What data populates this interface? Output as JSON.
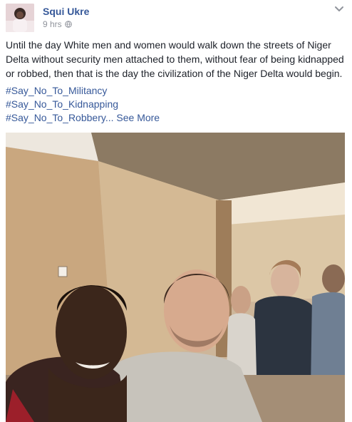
{
  "post": {
    "author": "Squi Ukre",
    "timestamp": "9 hrs",
    "text": "Until the day White men and women would walk down the streets of Niger Delta without security men attached to them, without fear of being kidnapped or robbed, then that is the day the civilization of the Niger Delta would begin.",
    "hashtags": [
      "#Say_No_To_Militancy",
      "#Say_No_To_Kidnapping",
      "#Say_No_To_Robbery..."
    ],
    "see_more": "See More",
    "icons": {
      "privacy": "globe-icon",
      "options": "chevron-down-icon"
    }
  },
  "colors": {
    "link": "#365899",
    "text": "#1d2129",
    "meta": "#90949c"
  }
}
